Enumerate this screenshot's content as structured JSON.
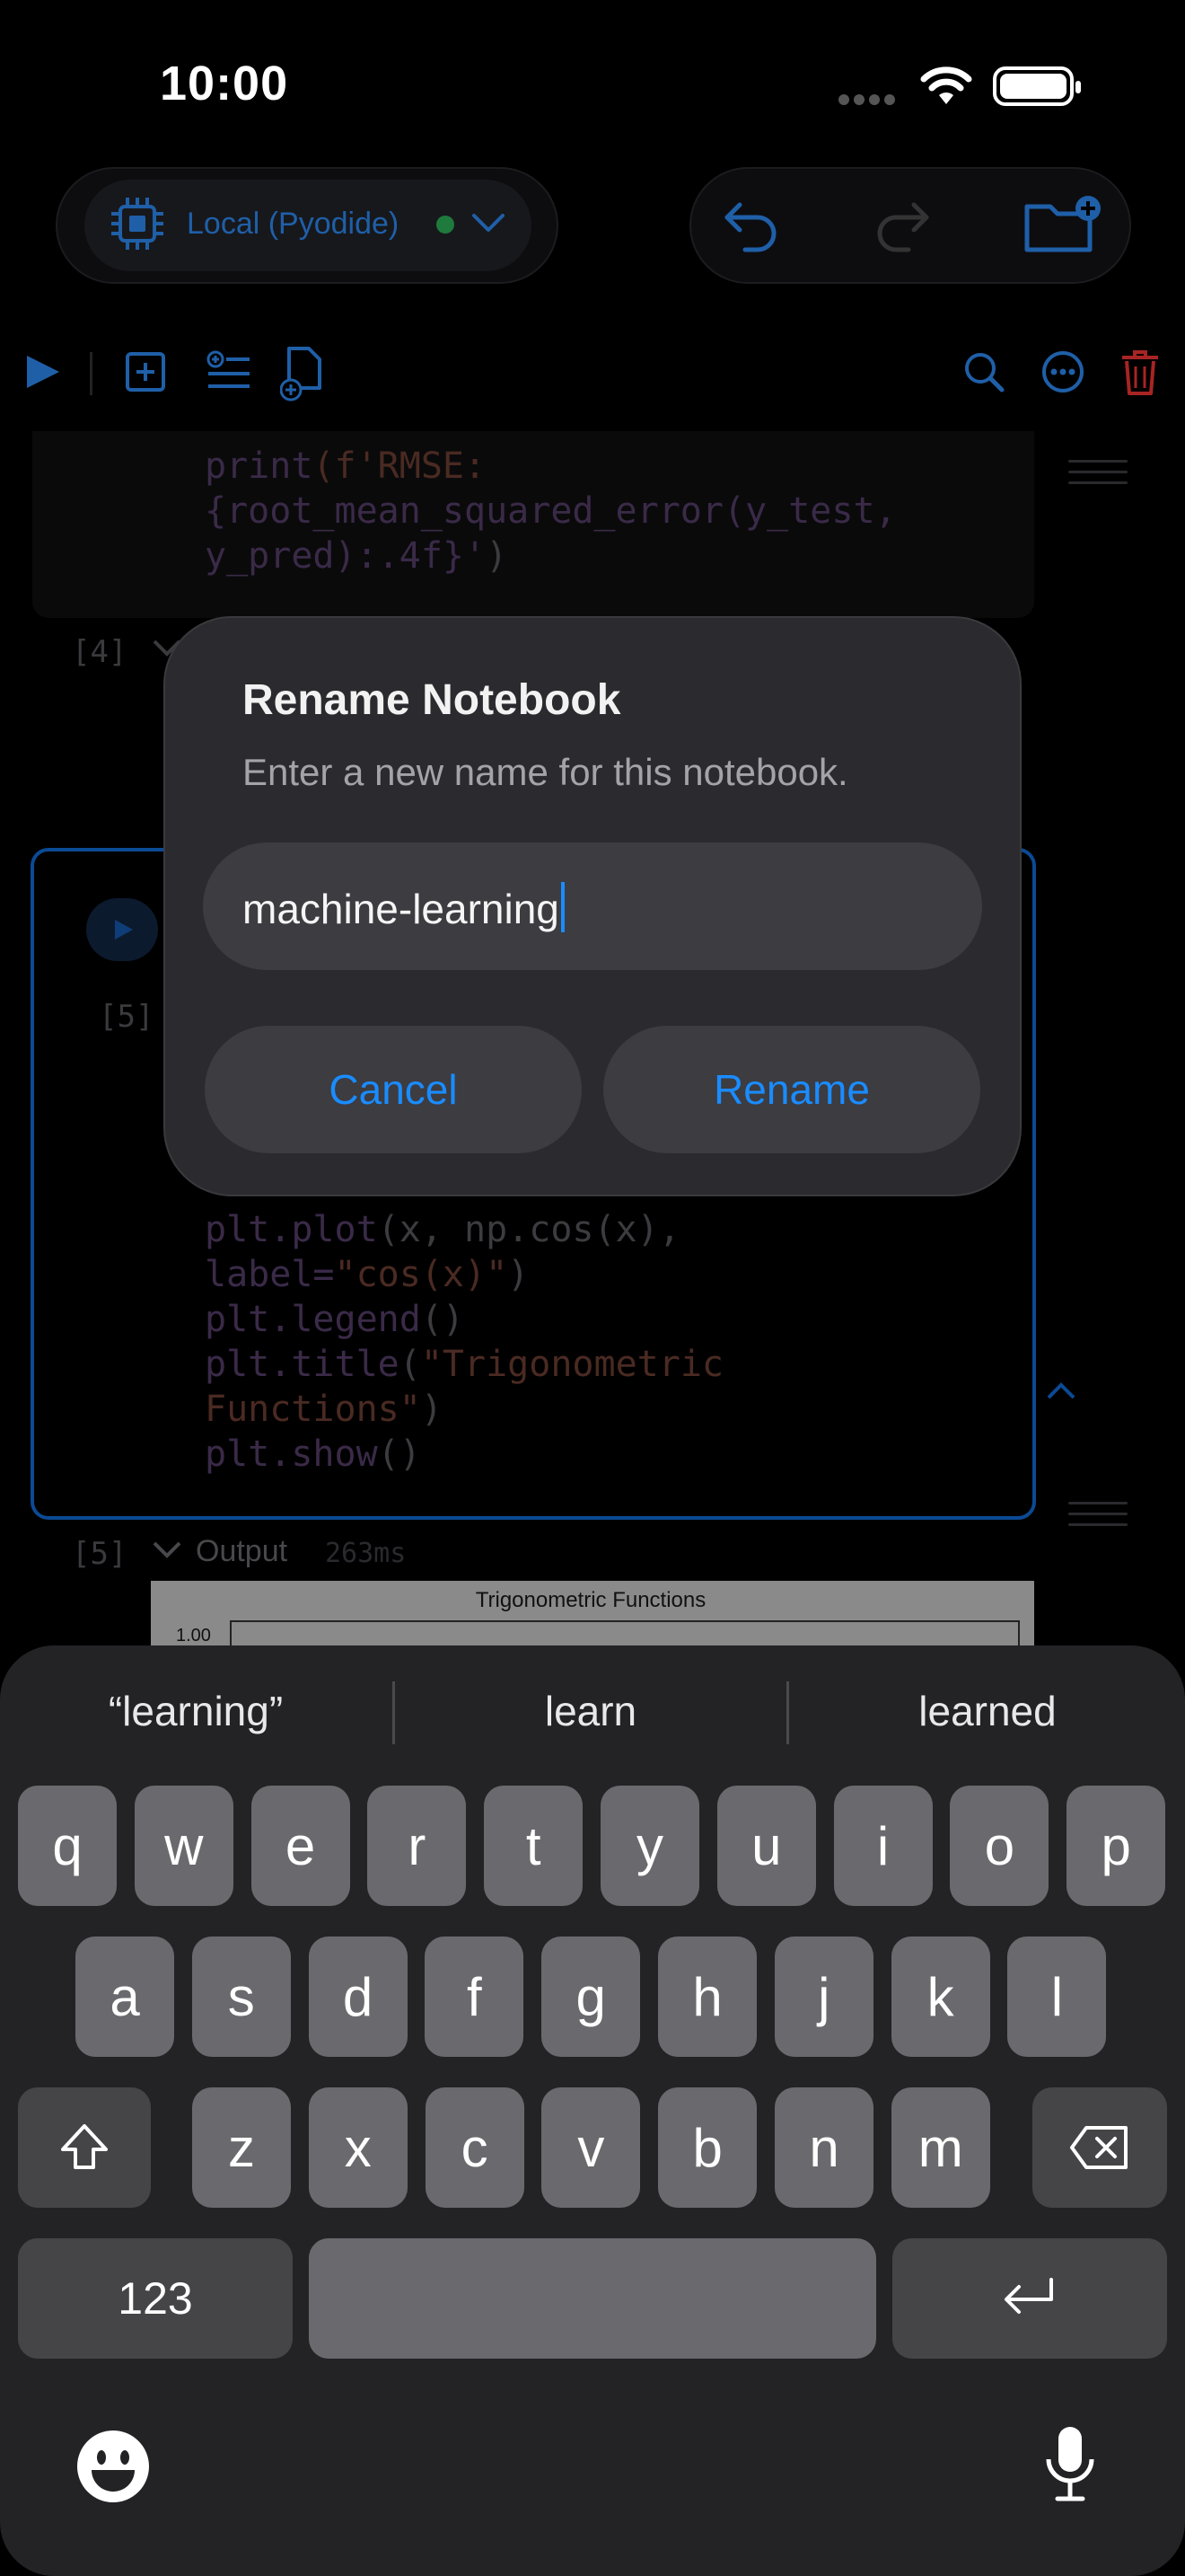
{
  "status_bar": {
    "time": "10:00"
  },
  "kernel": {
    "label": "Local (Pyodide)",
    "status_color": "#1f7a3d",
    "accent": "#1f5fa8"
  },
  "top_cell": {
    "code_lines": [
      [
        {
          "t": "print",
          "c": "fn"
        },
        {
          "t": "(f'RMSE:",
          "c": "str"
        }
      ],
      [
        {
          "t": "{root_mean_squared_error(y_test,",
          "c": "fn"
        }
      ],
      [
        {
          "t": "y_pred):.4f}'",
          "c": "fn"
        },
        {
          "t": ")",
          "c": "plain"
        }
      ]
    ]
  },
  "cell4": {
    "exec_label": "[4]"
  },
  "cell5": {
    "exec_label": "[5]",
    "code_lines": [
      [
        {
          "t": "plt.plot",
          "c": "fn"
        },
        {
          "t": "(x, np.cos(x),",
          "c": "plain"
        }
      ],
      [
        {
          "t": "label=",
          "c": "fn"
        },
        {
          "t": "\"cos(x)\"",
          "c": "str"
        },
        {
          "t": ")",
          "c": "plain"
        }
      ],
      [
        {
          "t": "plt.legend",
          "c": "fn"
        },
        {
          "t": "()",
          "c": "plain"
        }
      ],
      [
        {
          "t": "plt.title",
          "c": "fn"
        },
        {
          "t": "(",
          "c": "plain"
        },
        {
          "t": "\"Trigonometric",
          "c": "str"
        }
      ],
      [
        {
          "t": "Functions\"",
          "c": "str"
        },
        {
          "t": ")",
          "c": "plain"
        }
      ],
      [
        {
          "t": "plt.show",
          "c": "fn"
        },
        {
          "t": "()",
          "c": "plain"
        }
      ]
    ]
  },
  "output": {
    "exec_label": "[5]",
    "label": "Output",
    "time": "263ms",
    "plot_title": "Trigonometric Functions",
    "plot_tick": "1.00"
  },
  "dialog": {
    "title": "Rename Notebook",
    "subtitle": "Enter a new name for this notebook.",
    "input_value": "machine-learning",
    "cancel_label": "Cancel",
    "rename_label": "Rename",
    "accent": "#1a8cff"
  },
  "keyboard": {
    "suggestions": [
      "“learning”",
      "learn",
      "learned"
    ],
    "row1": [
      "q",
      "w",
      "e",
      "r",
      "t",
      "y",
      "u",
      "i",
      "o",
      "p"
    ],
    "row2": [
      "a",
      "s",
      "d",
      "f",
      "g",
      "h",
      "j",
      "k",
      "l"
    ],
    "row3": [
      "z",
      "x",
      "c",
      "v",
      "b",
      "n",
      "m"
    ],
    "numbers_label": "123"
  }
}
